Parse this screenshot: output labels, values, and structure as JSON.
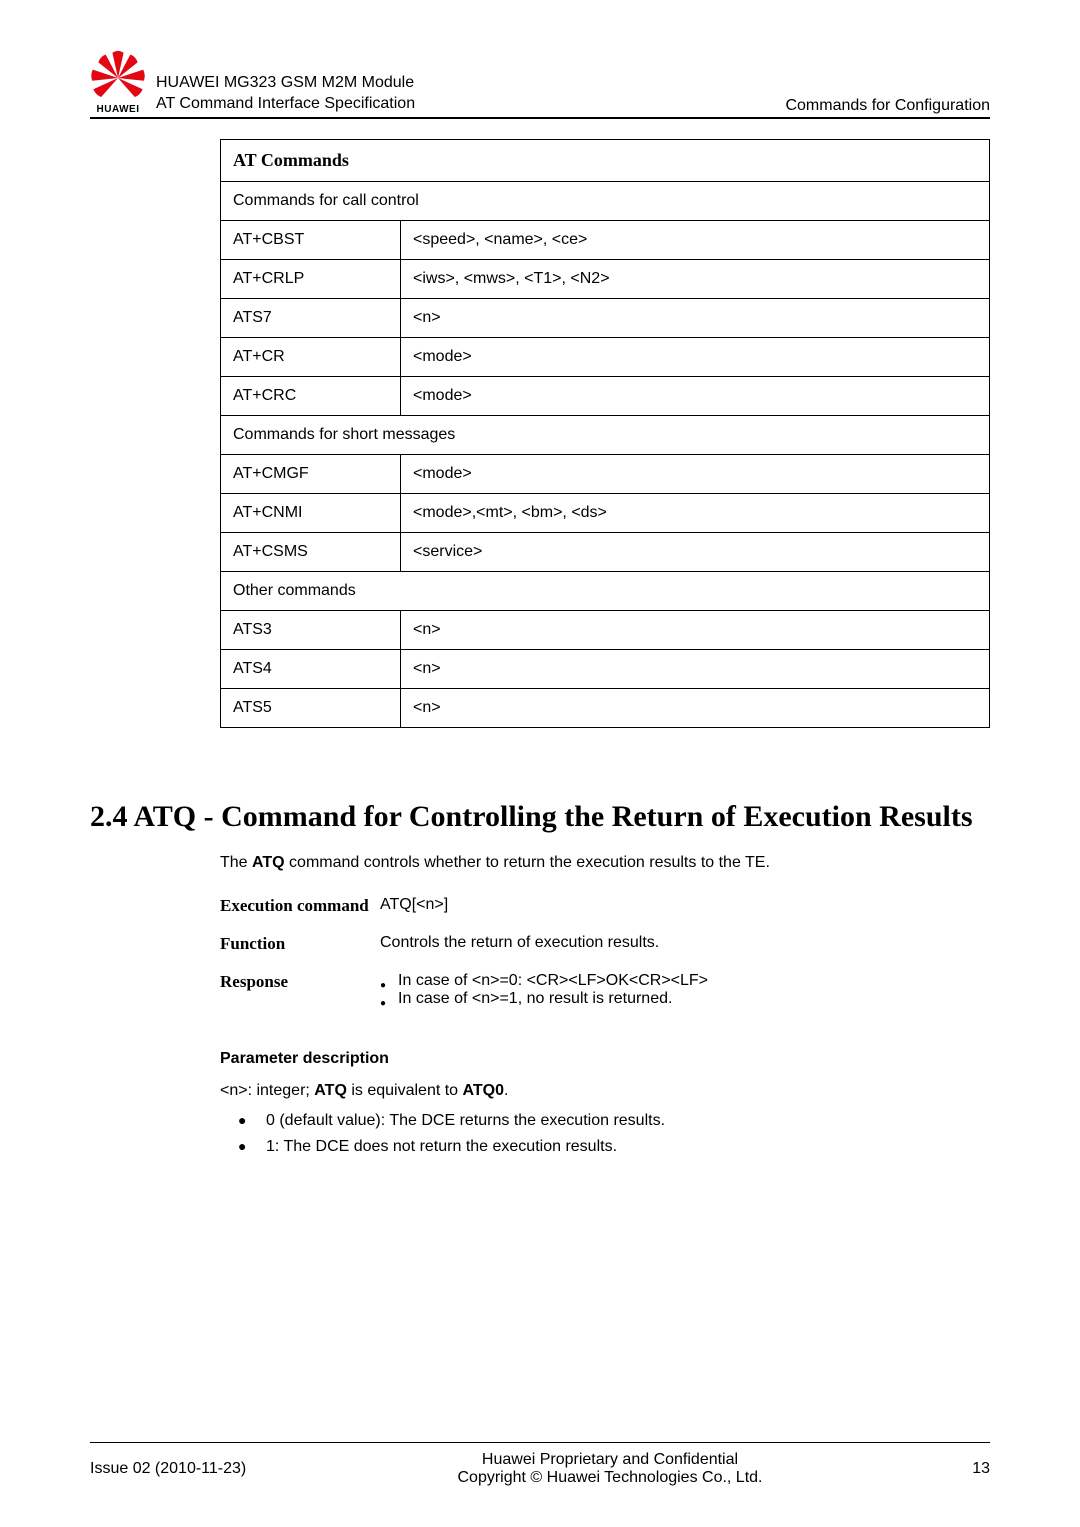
{
  "header": {
    "brand": "HUAWEI",
    "line1": "HUAWEI MG323 GSM M2M Module",
    "line2": "AT Command Interface Specification",
    "right": "Commands for Configuration"
  },
  "table": {
    "header": "AT Commands",
    "rows": [
      {
        "type": "full",
        "text": "Commands for call control"
      },
      {
        "type": "pair",
        "c1": "AT+CBST",
        "c2": "<speed>, <name>, <ce>"
      },
      {
        "type": "pair",
        "c1": "AT+CRLP",
        "c2": "<iws>, <mws>, <T1>, <N2>"
      },
      {
        "type": "pair",
        "c1": "ATS7",
        "c2": "<n>"
      },
      {
        "type": "pair",
        "c1": "AT+CR",
        "c2": "<mode>"
      },
      {
        "type": "pair",
        "c1": "AT+CRC",
        "c2": "<mode>"
      },
      {
        "type": "full",
        "text": "Commands for short messages"
      },
      {
        "type": "pair",
        "c1": "AT+CMGF",
        "c2": "<mode>"
      },
      {
        "type": "pair",
        "c1": "AT+CNMI",
        "c2": "<mode>,<mt>, <bm>, <ds>"
      },
      {
        "type": "pair",
        "c1": "AT+CSMS",
        "c2": "<service>"
      },
      {
        "type": "full",
        "text": "Other commands"
      },
      {
        "type": "pair",
        "c1": "ATS3",
        "c2": "<n>"
      },
      {
        "type": "pair",
        "c1": "ATS4",
        "c2": "<n>"
      },
      {
        "type": "pair",
        "c1": "ATS5",
        "c2": "<n>"
      }
    ]
  },
  "section": {
    "title": "2.4 ATQ - Command for Controlling the Return of Execution Results",
    "intro_pre": "The ",
    "intro_bold": "ATQ",
    "intro_post": " command controls whether to return the execution results to the TE."
  },
  "defs": {
    "exec_label": "Execution command",
    "exec_val": "ATQ[<n>]",
    "func_label": "Function",
    "func_val": "Controls the return of execution results.",
    "resp_label": "Response",
    "resp_1": "In case of <n>=0: <CR><LF>OK<CR><LF>",
    "resp_2": "In case of <n>=1, no result is returned."
  },
  "param": {
    "title": "Parameter description",
    "line_pre": "<n>: integer; ",
    "b1": "ATQ",
    "mid": " is equivalent to ",
    "b2": "ATQ0",
    "post": ".",
    "items": [
      "0 (default value): The DCE returns the execution results.",
      "1: The DCE does not return the execution results."
    ]
  },
  "footer": {
    "left": "Issue 02 (2010-11-23)",
    "c1": "Huawei Proprietary and Confidential",
    "c2": "Copyright © Huawei Technologies Co., Ltd.",
    "right": "13"
  }
}
